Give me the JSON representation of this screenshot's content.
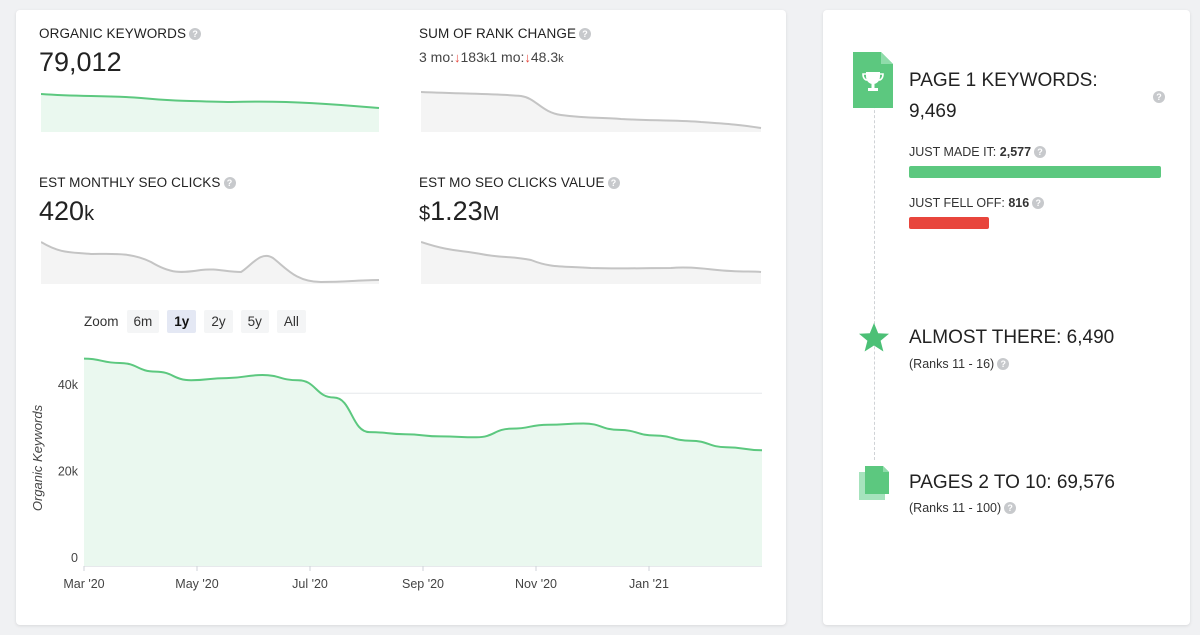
{
  "metrics": {
    "organic_keywords": {
      "label": "ORGANIC KEYWORDS",
      "value": "79,012"
    },
    "rank_change": {
      "label": "SUM OF RANK CHANGE",
      "p1_label": "3 mo:",
      "p1_arrow": "↓",
      "p1_value": "183",
      "p1_unit": "k",
      "p2_label": "1 mo:",
      "p2_arrow": "↓",
      "p2_value": "48.3",
      "p2_unit": "k"
    },
    "est_clicks": {
      "label": "EST MONTHLY SEO CLICKS",
      "value": "420",
      "unit": "k"
    },
    "clicks_value": {
      "label": "EST MO SEO CLICKS VALUE",
      "prefix": "$",
      "value": "1.23",
      "unit": "M"
    }
  },
  "zoom": {
    "label": "Zoom",
    "options": [
      "6m",
      "1y",
      "2y",
      "5y",
      "All"
    ],
    "active": "1y"
  },
  "chart_data": {
    "type": "area",
    "ylabel": "Organic Keywords",
    "ylim": [
      0,
      50000
    ],
    "yticks": [
      0,
      20000,
      40000
    ],
    "ytick_labels": [
      "0",
      "20k",
      "40k"
    ],
    "xtick_labels": [
      "Mar '20",
      "May '20",
      "Jul '20",
      "Sep '20",
      "Nov '20",
      "Jan '21"
    ],
    "series": [
      {
        "values": [
          48000,
          47000,
          45000,
          43000,
          43500,
          44200,
          43000,
          39000,
          31000,
          30500,
          30000,
          29800,
          31800,
          32700,
          33000,
          31500,
          30200,
          29000,
          27500,
          26800
        ]
      }
    ],
    "line_color": "#5cc87f",
    "fill_color": "#eaf8ef"
  },
  "help_glyph": "?",
  "right": {
    "page1": {
      "label": "PAGE 1 KEYWORDS:",
      "value": "9,469",
      "icon": "trophy-document-icon"
    },
    "just_made": {
      "label": "JUST MADE IT:",
      "value": "2,577",
      "bar_fraction": 1.0,
      "color": "#5cc87f"
    },
    "just_fell": {
      "label": "JUST FELL OFF:",
      "value": "816",
      "bar_fraction": 0.317,
      "color": "#e8453c"
    },
    "almost": {
      "label": "ALMOST THERE:",
      "value": "6,490",
      "sub": "(Ranks 11 - 16)",
      "icon": "star-icon"
    },
    "pages": {
      "label": "PAGES 2 TO 10:",
      "value": "69,576",
      "sub": "(Ranks 11 - 100)",
      "icon": "pages-icon"
    }
  },
  "colors": {
    "accent_green": "#5cc87f",
    "red": "#e8453c",
    "spark_gray": "#c4c4c4"
  }
}
